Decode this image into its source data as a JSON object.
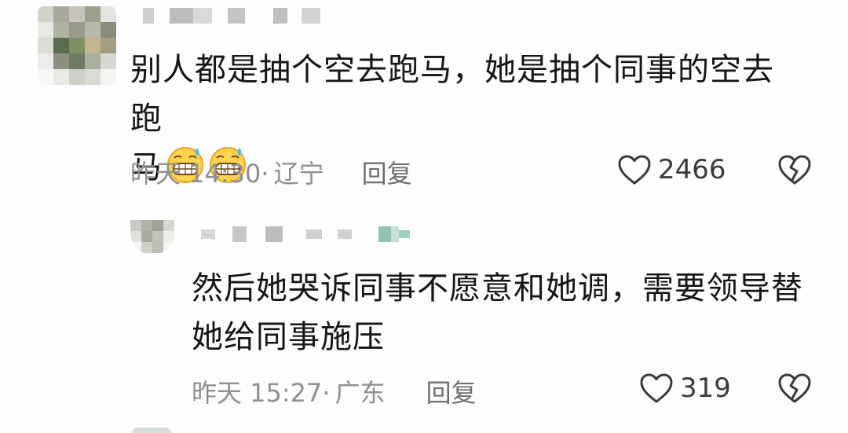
{
  "comments": [
    {
      "text_line1": "别人都是抽个空去跑马，她是抽个同事的空去跑",
      "text_line2": "马",
      "emoji": [
        "grinning-sweat-emoji",
        "grinning-sweat-emoji"
      ],
      "time": "昨天 14:30·",
      "location": "辽宁",
      "reply_label": "回复",
      "likes": "2466"
    },
    {
      "text_line1": "然后她哭诉同事不愿意和她调，需要领导替",
      "text_line2": "她给同事施压",
      "time": "昨天 15:27·",
      "location": "广东",
      "reply_label": "回复",
      "likes": "319"
    }
  ],
  "colors": {
    "text": "#151515",
    "meta": "#8e8e93",
    "icon": "#3a3a3c"
  },
  "icons": [
    "heart-outline-icon",
    "broken-heart-icon"
  ]
}
